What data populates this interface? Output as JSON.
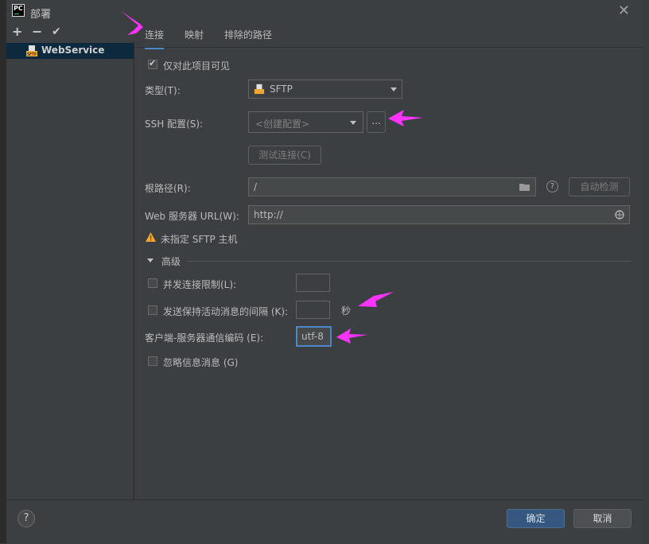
{
  "window": {
    "title": "部署",
    "app_icon": "PC"
  },
  "toolbar": {
    "add": "+",
    "remove": "−",
    "apply": "✔"
  },
  "sidebar": {
    "items": [
      {
        "label": "WebService",
        "icon": "sftp-server-icon"
      }
    ]
  },
  "tabs": [
    {
      "label": "连接",
      "active": true
    },
    {
      "label": "映射"
    },
    {
      "label": "排除的路径"
    }
  ],
  "connection": {
    "visible_only_label": "仅对此项目可见",
    "visible_only_checked": true,
    "type_label": "类型(T):",
    "type_value": "SFTP",
    "ssh_label": "SSH 配置(S):",
    "ssh_placeholder": "<创建配置>",
    "ssh_more": "...",
    "test_button": "测试连接(C)",
    "root_label": "根路径(R):",
    "root_value": "/",
    "autodetect_button": "自动检测",
    "url_label": "Web 服务器 URL(W):",
    "url_value": "http://",
    "warning_text": "未指定 SFTP 主机"
  },
  "advanced": {
    "section_label": "高级",
    "concurrent_label": "并发连接限制(L):",
    "concurrent_value": "",
    "keepalive_label": "发送保持活动消息的间隔 (K):",
    "keepalive_value": "",
    "keepalive_unit": "秒",
    "encoding_label": "客户端-服务器通信编码 (E):",
    "encoding_value": "utf-8",
    "ignore_label": "忽略信息消息 (G)"
  },
  "footer": {
    "help": "?",
    "ok": "确定",
    "cancel": "取消"
  },
  "colors": {
    "accent": "#4a88c7",
    "annotation": "#ff33ff",
    "selection": "#0d293e",
    "ok_button": "#365880",
    "warning": "#f0a732"
  }
}
